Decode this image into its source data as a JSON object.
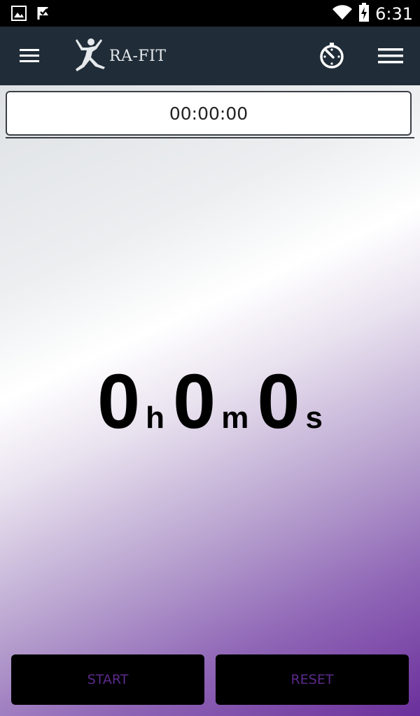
{
  "status_bar": {
    "time": "6:31",
    "icons": [
      "image-icon",
      "check-flag-icon",
      "wifi-icon",
      "battery-charging-icon"
    ]
  },
  "app_bar": {
    "logo_text": "RA-FIT",
    "icons": [
      "hamburger-menu-icon",
      "runner-logo-icon",
      "stopwatch-icon",
      "overflow-menu-icon"
    ]
  },
  "time_field": {
    "value": "00:00:00"
  },
  "counter": {
    "hours": "0",
    "hours_unit": "h",
    "minutes": "0",
    "minutes_unit": "m",
    "seconds": "0",
    "seconds_unit": "s"
  },
  "buttons": {
    "start_label": "START",
    "reset_label": "RESET"
  },
  "colors": {
    "app_bar": "#202d38",
    "button_text": "#5b2a8a",
    "gradient_end": "#6b2f9b"
  }
}
